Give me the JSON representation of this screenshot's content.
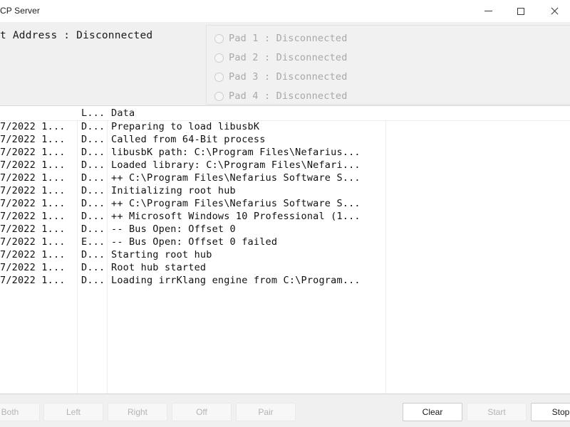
{
  "window": {
    "title": "CP Server",
    "controls": {
      "minimize_label": "Minimize",
      "maximize_label": "Maximize",
      "close_label": "Close"
    }
  },
  "status_panel": {
    "host_address_line": "t Address : Disconnected",
    "pads": [
      {
        "label": "Pad 1 : Disconnected",
        "checked": false,
        "enabled": false
      },
      {
        "label": "Pad 2 : Disconnected",
        "checked": false,
        "enabled": false
      },
      {
        "label": "Pad 3 : Disconnected",
        "checked": false,
        "enabled": false
      },
      {
        "label": "Pad 4 : Disconnected",
        "checked": false,
        "enabled": false
      }
    ]
  },
  "log": {
    "columns": {
      "time": "",
      "level": "L...",
      "data": "Data"
    },
    "rows": [
      {
        "time": "7/2022 1...",
        "level": "D...",
        "data": "Preparing to load libusbK"
      },
      {
        "time": "7/2022 1...",
        "level": "D...",
        "data": "Called from 64-Bit process"
      },
      {
        "time": "7/2022 1...",
        "level": "D...",
        "data": "libusbK path: C:\\Program Files\\Nefarius..."
      },
      {
        "time": "7/2022 1...",
        "level": "D...",
        "data": "Loaded library: C:\\Program Files\\Nefari..."
      },
      {
        "time": "7/2022 1...",
        "level": "D...",
        "data": "++ C:\\Program Files\\Nefarius Software S..."
      },
      {
        "time": "7/2022 1...",
        "level": "D...",
        "data": "Initializing root hub"
      },
      {
        "time": "7/2022 1...",
        "level": "D...",
        "data": "++ C:\\Program Files\\Nefarius Software S..."
      },
      {
        "time": "7/2022 1...",
        "level": "D...",
        "data": "++ Microsoft Windows 10 Professional (1..."
      },
      {
        "time": "7/2022 1...",
        "level": "D...",
        "data": "-- Bus Open: Offset 0"
      },
      {
        "time": "7/2022 1...",
        "level": "E...",
        "data": "-- Bus Open: Offset 0 failed"
      },
      {
        "time": "7/2022 1...",
        "level": "D...",
        "data": "Starting root hub"
      },
      {
        "time": "7/2022 1...",
        "level": "D...",
        "data": "Root hub started"
      },
      {
        "time": "7/2022 1...",
        "level": "D...",
        "data": "Loading irrKlang engine from C:\\Program..."
      }
    ]
  },
  "toolbar": {
    "both_label": "Both",
    "left_label": "Left",
    "right_label": "Right",
    "off_label": "Off",
    "pair_label": "Pair",
    "clear_label": "Clear",
    "start_label": "Start",
    "stop_label": "Stop"
  }
}
